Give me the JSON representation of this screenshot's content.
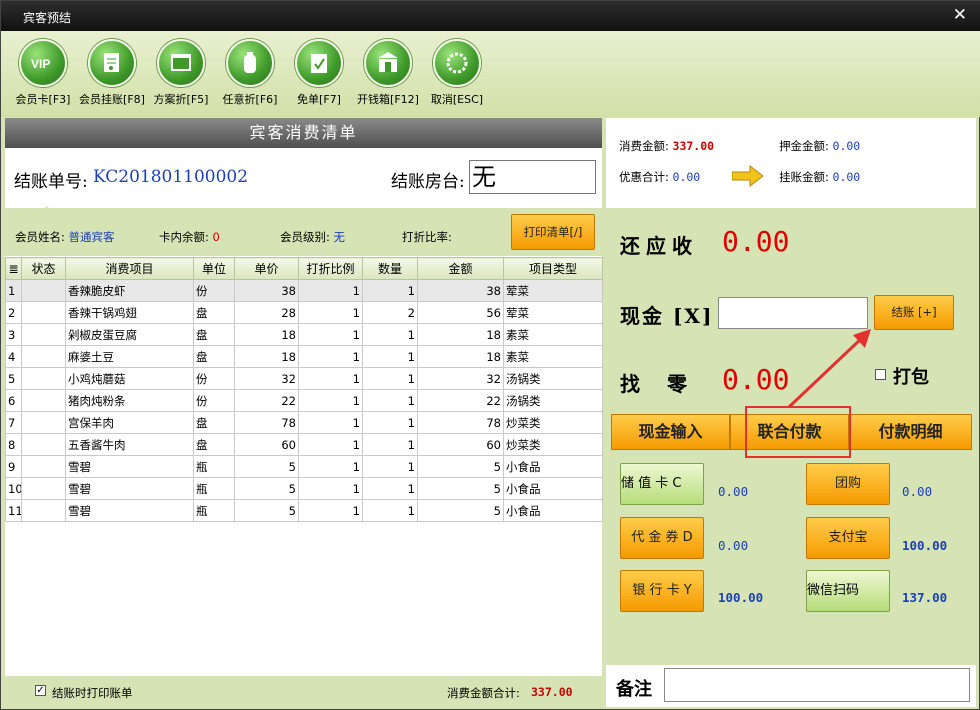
{
  "window": {
    "title": "宾客预结",
    "close": "✕"
  },
  "toolbar": [
    {
      "label": "会员卡[F3]",
      "icon": "vip-card-icon",
      "glyph": "VIP"
    },
    {
      "label": "会员挂账[F8]",
      "icon": "member-credit-icon",
      "glyph": "doc"
    },
    {
      "label": "方案折[F5]",
      "icon": "plan-discount-icon",
      "glyph": "win"
    },
    {
      "label": "任意折[F6]",
      "icon": "custom-discount-icon",
      "glyph": "bottle"
    },
    {
      "label": "免单[F7]",
      "icon": "free-bill-icon",
      "glyph": "check"
    },
    {
      "label": "开钱箱[F12]",
      "icon": "cash-drawer-icon",
      "glyph": "bank"
    },
    {
      "label": "取消[ESC]",
      "icon": "cancel-icon",
      "glyph": "spin"
    }
  ],
  "bill": {
    "header": "宾客消费清单",
    "no_label": "结账单号:",
    "no_value": "KC201801100002",
    "room_label": "结账房台:",
    "room_value": "无",
    "member_name_label": "会员姓名:",
    "member_name": "普通宾客",
    "card_balance_label": "卡内余额:",
    "card_balance": "0",
    "member_level_label": "会员级别:",
    "member_level": "无",
    "discount_rate_label": "打折比率:",
    "discount_rate": "",
    "print_button": "打印清单[/]"
  },
  "table": {
    "columns": [
      "≣",
      "状态",
      "消费项目",
      "单位",
      "单价",
      "打折比例",
      "数量",
      "金额",
      "项目类型"
    ],
    "rows": [
      [
        "1",
        "",
        "香辣脆皮虾",
        "份",
        "38",
        "1",
        "1",
        "38",
        "荤菜"
      ],
      [
        "2",
        "",
        "香辣干锅鸡翅",
        "盘",
        "28",
        "1",
        "2",
        "56",
        "荤菜"
      ],
      [
        "3",
        "",
        "剁椒皮蛋豆腐",
        "盘",
        "18",
        "1",
        "1",
        "18",
        "素菜"
      ],
      [
        "4",
        "",
        "麻婆土豆",
        "盘",
        "18",
        "1",
        "1",
        "18",
        "素菜"
      ],
      [
        "5",
        "",
        "小鸡炖蘑菇",
        "份",
        "32",
        "1",
        "1",
        "32",
        "汤锅类"
      ],
      [
        "6",
        "",
        "猪肉炖粉条",
        "份",
        "22",
        "1",
        "1",
        "22",
        "汤锅类"
      ],
      [
        "7",
        "",
        "宫保羊肉",
        "盘",
        "78",
        "1",
        "1",
        "78",
        "炒菜类"
      ],
      [
        "8",
        "",
        "五香酱牛肉",
        "盘",
        "60",
        "1",
        "1",
        "60",
        "炒菜类"
      ],
      [
        "9",
        "",
        "雪碧",
        "瓶",
        "5",
        "1",
        "1",
        "5",
        "小食品"
      ],
      [
        "10",
        "",
        "雪碧",
        "瓶",
        "5",
        "1",
        "1",
        "5",
        "小食品"
      ],
      [
        "11",
        "",
        "雪碧",
        "瓶",
        "5",
        "1",
        "1",
        "5",
        "小食品"
      ]
    ]
  },
  "footer": {
    "print_on_checkout_label": "结账时打印账单",
    "print_on_checkout_checked": true,
    "total_label": "消费金额合计:",
    "total_value": "337.00"
  },
  "summary": {
    "consume_label": "消费金额:",
    "consume_value": "337.00",
    "deposit_label": "押金金额:",
    "deposit_value": "0.00",
    "discount_label": "优惠合计:",
    "discount_value": "0.00",
    "credit_label": "挂账金额:",
    "credit_value": "0.00"
  },
  "payment": {
    "due_label": "还应收",
    "due_value": "0.00",
    "cash_label": "现金 [X]",
    "cash_value": "",
    "checkout_button": "结账 [+]",
    "change_label": "找　 零",
    "change_value": "0.00",
    "pack_label": "打包",
    "pack_checked": false,
    "tabs": [
      "现金输入",
      "联合付款",
      "付款明细"
    ],
    "methods": [
      {
        "label": "储 值 卡 C",
        "value": "0.00",
        "style": "green",
        "bold": false
      },
      {
        "label": "团购",
        "value": "0.00",
        "style": "orange",
        "bold": false
      },
      {
        "label": "代 金 券 D",
        "value": "0.00",
        "style": "orange",
        "bold": false
      },
      {
        "label": "支付宝",
        "value": "100.00",
        "style": "orange",
        "bold": true
      },
      {
        "label": "银 行 卡 Y",
        "value": "100.00",
        "style": "orange",
        "bold": true
      },
      {
        "label": "微信扫码",
        "value": "137.00",
        "style": "green",
        "bold": true
      }
    ],
    "notes_label": "备注",
    "notes_value": ""
  },
  "colors": {
    "accent_orange": "#f59a00",
    "amount_red": "#e10000",
    "value_blue": "#1a3fb8",
    "bg_green": "#d6e3b4",
    "annotation_red": "#e53030"
  }
}
